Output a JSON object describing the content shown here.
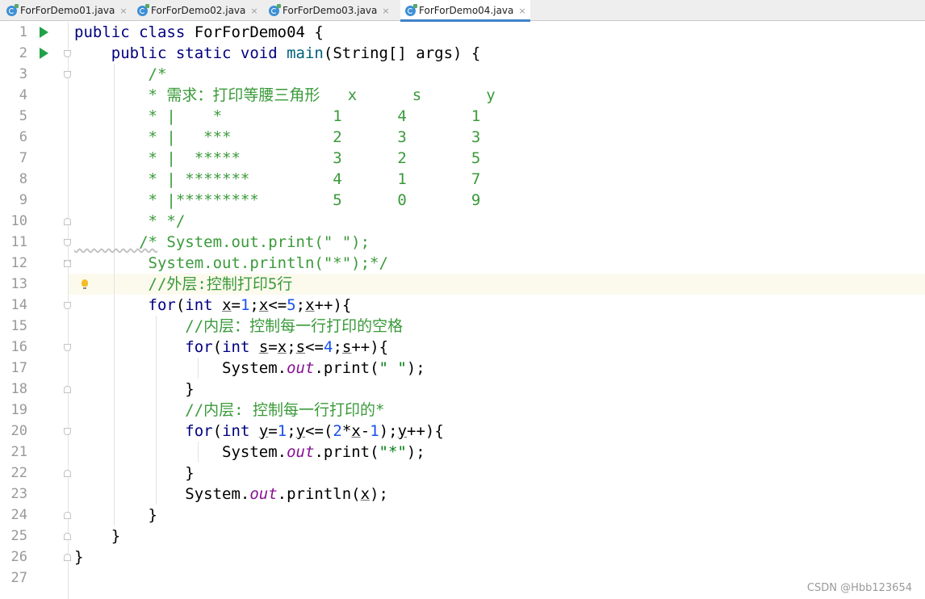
{
  "tabs": [
    {
      "label": "ForForDemo01.java",
      "active": false
    },
    {
      "label": "ForForDemo02.java",
      "active": false
    },
    {
      "label": "ForForDemo03.java",
      "active": false
    },
    {
      "label": "ForForDemo04.java",
      "active": true
    }
  ],
  "tab_close_glyph": "×",
  "editor": {
    "current_line": 13,
    "line_numbers": [
      "1",
      "2",
      "3",
      "4",
      "5",
      "6",
      "7",
      "8",
      "9",
      "10",
      "11",
      "12",
      "13",
      "14",
      "15",
      "16",
      "17",
      "18",
      "19",
      "20",
      "21",
      "22",
      "23",
      "24",
      "25",
      "26",
      "27"
    ],
    "lines": [
      [
        {
          "t": "public class ",
          "k": "kw"
        },
        {
          "t": "ForForDemo04 {"
        }
      ],
      [
        {
          "t": "    public static void ",
          "k": "kw"
        },
        {
          "t": "main",
          "k": "fn"
        },
        {
          "t": "(String[] args) {"
        }
      ],
      [
        {
          "t": "        /*",
          "k": "cm"
        }
      ],
      [
        {
          "t": "        * 需求：打印等腰三角形   x      s       y",
          "k": "cm"
        }
      ],
      [
        {
          "t": "        * |    *            1      4       1",
          "k": "cm"
        }
      ],
      [
        {
          "t": "        * |   ***           2      3       3",
          "k": "cm"
        }
      ],
      [
        {
          "t": "        * |  *****          3      2       5",
          "k": "cm"
        }
      ],
      [
        {
          "t": "        * | *******         4      1       7",
          "k": "cm"
        }
      ],
      [
        {
          "t": "        * |*********        5      0       9",
          "k": "cm"
        }
      ],
      [
        {
          "t": "        * */",
          "k": "cm"
        }
      ],
      [
        {
          "t": "       /*",
          "k": "cm wavy"
        },
        {
          "t": " System.out.print(\" \");",
          "k": "cm"
        }
      ],
      [
        {
          "t": "        System.out.println(\"*\");*/",
          "k": "cm"
        }
      ],
      [
        {
          "t": "        //外层:控制打印5行",
          "k": "cm"
        }
      ],
      [
        {
          "t": "        "
        },
        {
          "t": "for",
          "k": "kw"
        },
        {
          "t": "("
        },
        {
          "t": "int ",
          "k": "kw"
        },
        {
          "t": "x",
          "k": "ul"
        },
        {
          "t": "="
        },
        {
          "t": "1",
          "k": "num"
        },
        {
          "t": ";"
        },
        {
          "t": "x",
          "k": "ul"
        },
        {
          "t": "<="
        },
        {
          "t": "5",
          "k": "num"
        },
        {
          "t": ";"
        },
        {
          "t": "x",
          "k": "ul"
        },
        {
          "t": "++){"
        }
      ],
      [
        {
          "t": "            //内层：控制每一行打印的空格",
          "k": "cm"
        }
      ],
      [
        {
          "t": "            "
        },
        {
          "t": "for",
          "k": "kw"
        },
        {
          "t": "("
        },
        {
          "t": "int ",
          "k": "kw"
        },
        {
          "t": "s",
          "k": "ul"
        },
        {
          "t": "="
        },
        {
          "t": "x",
          "k": "ul"
        },
        {
          "t": ";"
        },
        {
          "t": "s",
          "k": "ul"
        },
        {
          "t": "<="
        },
        {
          "t": "4",
          "k": "num"
        },
        {
          "t": ";"
        },
        {
          "t": "s",
          "k": "ul"
        },
        {
          "t": "++){"
        }
      ],
      [
        {
          "t": "                System."
        },
        {
          "t": "out",
          "k": "fld"
        },
        {
          "t": ".print("
        },
        {
          "t": "\" \"",
          "k": "str"
        },
        {
          "t": ");"
        }
      ],
      [
        {
          "t": "            }"
        }
      ],
      [
        {
          "t": "            //内层: 控制每一行打印的*",
          "k": "cm"
        }
      ],
      [
        {
          "t": "            "
        },
        {
          "t": "for",
          "k": "kw"
        },
        {
          "t": "("
        },
        {
          "t": "int ",
          "k": "kw"
        },
        {
          "t": "y",
          "k": "ul"
        },
        {
          "t": "="
        },
        {
          "t": "1",
          "k": "num"
        },
        {
          "t": ";"
        },
        {
          "t": "y",
          "k": "ul"
        },
        {
          "t": "<=("
        },
        {
          "t": "2",
          "k": "num"
        },
        {
          "t": "*"
        },
        {
          "t": "x",
          "k": "ul"
        },
        {
          "t": "-"
        },
        {
          "t": "1",
          "k": "num"
        },
        {
          "t": ");"
        },
        {
          "t": "y",
          "k": "ul"
        },
        {
          "t": "++){"
        }
      ],
      [
        {
          "t": "                System."
        },
        {
          "t": "out",
          "k": "fld"
        },
        {
          "t": ".print("
        },
        {
          "t": "\"*\"",
          "k": "str"
        },
        {
          "t": ");"
        }
      ],
      [
        {
          "t": "            }"
        }
      ],
      [
        {
          "t": "            System."
        },
        {
          "t": "out",
          "k": "fld"
        },
        {
          "t": ".println("
        },
        {
          "t": "x",
          "k": "ul"
        },
        {
          "t": ");"
        }
      ],
      [
        {
          "t": "        }"
        }
      ],
      [
        {
          "t": "    }"
        }
      ],
      [
        {
          "t": "}"
        }
      ],
      []
    ]
  },
  "watermark": "CSDN @Hbb123654",
  "colors": {
    "keyword": "#000080",
    "comment": "#3a9a3a",
    "string": "#067d17",
    "number": "#1750eb",
    "field": "#871094",
    "run_icon": "#21a148",
    "current_line_bg": "#fcfaed"
  },
  "icons": {
    "tab_icon": "java-class-icon",
    "run_icon": "run-triangle-icon",
    "fold_icon": "fold-marker-icon",
    "bulb_icon": "intention-bulb-icon"
  }
}
